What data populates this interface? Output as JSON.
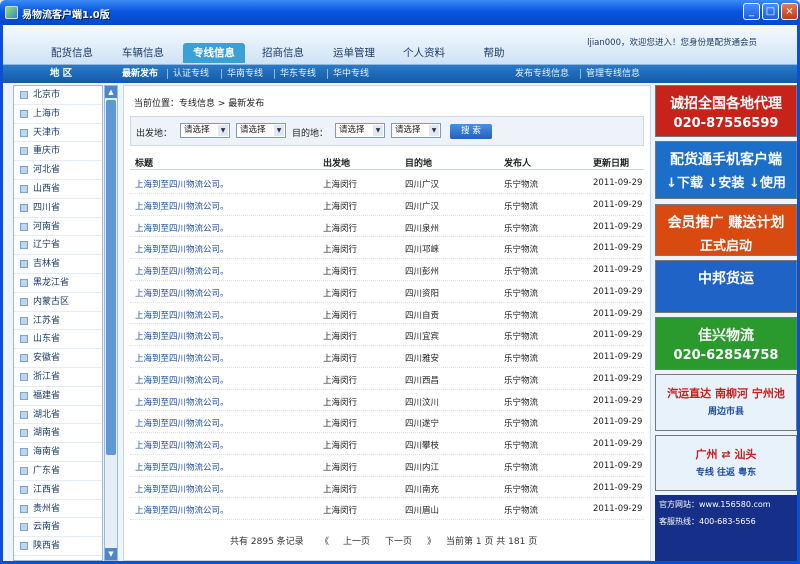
{
  "window": {
    "title": "易物流客户端1.0版",
    "min": "_",
    "max": "□",
    "close": "×"
  },
  "menu": {
    "items": [
      "配货信息",
      "车辆信息",
      "专线信息",
      "招商信息",
      "运单管理",
      "个人资料",
      "帮助"
    ],
    "active_index": 2,
    "user_text": "ljian000，欢迎您进入！您身份是配货通会员"
  },
  "subnav": {
    "region_header": "地 区",
    "left": [
      "最新发布",
      "认证专线",
      "华南专线",
      "华东专线",
      "华中专线"
    ],
    "right": [
      "发布专线信息",
      "管理专线信息"
    ]
  },
  "regions": [
    "北京市",
    "上海市",
    "天津市",
    "重庆市",
    "河北省",
    "山西省",
    "四川省",
    "河南省",
    "辽宁省",
    "吉林省",
    "黑龙江省",
    "内蒙古区",
    "江苏省",
    "山东省",
    "安徽省",
    "浙江省",
    "福建省",
    "湖北省",
    "湖南省",
    "海南省",
    "广东省",
    "江西省",
    "贵州省",
    "云南省",
    "陕西省"
  ],
  "breadcrumb": "当前位置：专线信息 > 最新发布",
  "filter": {
    "from_label": "出发地：",
    "to_label": "目的地：",
    "select_placeholder": "请选择",
    "search_label": "搜 索"
  },
  "table": {
    "headers": [
      "标题",
      "出发地",
      "目的地",
      "发布人",
      "更新日期"
    ],
    "rows": [
      [
        "上海到至四川物流公司。",
        "上海闵行",
        "四川广汉",
        "乐宁物流",
        "2011-09-29"
      ],
      [
        "上海到至四川物流公司。",
        "上海闵行",
        "四川广汉",
        "乐宁物流",
        "2011-09-29"
      ],
      [
        "上海到至四川物流公司。",
        "上海闵行",
        "四川泉州",
        "乐宁物流",
        "2011-09-29"
      ],
      [
        "上海到至四川物流公司。",
        "上海闵行",
        "四川邛崃",
        "乐宁物流",
        "2011-09-29"
      ],
      [
        "上海到至四川物流公司。",
        "上海闵行",
        "四川彭州",
        "乐宁物流",
        "2011-09-29"
      ],
      [
        "上海到至四川物流公司。",
        "上海闵行",
        "四川资阳",
        "乐宁物流",
        "2011-09-29"
      ],
      [
        "上海到至四川物流公司。",
        "上海闵行",
        "四川自贡",
        "乐宁物流",
        "2011-09-29"
      ],
      [
        "上海到至四川物流公司。",
        "上海闵行",
        "四川宜宾",
        "乐宁物流",
        "2011-09-29"
      ],
      [
        "上海到至四川物流公司。",
        "上海闵行",
        "四川雅安",
        "乐宁物流",
        "2011-09-29"
      ],
      [
        "上海到至四川物流公司。",
        "上海闵行",
        "四川西昌",
        "乐宁物流",
        "2011-09-29"
      ],
      [
        "上海到至四川物流公司。",
        "上海闵行",
        "四川汶川",
        "乐宁物流",
        "2011-09-29"
      ],
      [
        "上海到至四川物流公司。",
        "上海闵行",
        "四川遂宁",
        "乐宁物流",
        "2011-09-29"
      ],
      [
        "上海到至四川物流公司。",
        "上海闵行",
        "四川攀枝",
        "乐宁物流",
        "2011-09-29"
      ],
      [
        "上海到至四川物流公司。",
        "上海闵行",
        "四川内江",
        "乐宁物流",
        "2011-09-29"
      ],
      [
        "上海到至四川物流公司。",
        "上海闵行",
        "四川南充",
        "乐宁物流",
        "2011-09-29"
      ],
      [
        "上海到至四川物流公司。",
        "上海闵行",
        "四川眉山",
        "乐宁物流",
        "2011-09-29"
      ]
    ]
  },
  "pager": {
    "total": "共有 2895 条记录",
    "first": "《",
    "prev": "上一页",
    "next": "下一页",
    "last": "》",
    "current": "当前第 1 页 共 181 页"
  },
  "ads": [
    {
      "line1": "诚招全国各地代理",
      "line2": "020-87556599",
      "bg": "#c8231b"
    },
    {
      "line1": "配货通手机客户端",
      "line2": "↓下载  ↓安装  ↓使用",
      "bg": "#1b6fc8"
    },
    {
      "line1": "会员推广 赚送计划",
      "line2": "正式启动",
      "bg": "#d84a10"
    },
    {
      "line1": "中邦货运",
      "line2": "",
      "bg": "#1f63c6"
    },
    {
      "line1": "佳兴物流",
      "line2": "020-62854758",
      "bg": "#2a9a2e"
    },
    {
      "line1": "汽运直达  南柳河 宁州池",
      "line2": "周边市县",
      "bg": "#e8f2fb"
    },
    {
      "line1": "广州 ⇄ 汕头",
      "line2": "专线 往返  粤东",
      "bg": "#e8f2fb"
    }
  ],
  "contact": {
    "site": "官方网站：www.156580.com",
    "hotline": "客服热线：400-683-5656"
  }
}
